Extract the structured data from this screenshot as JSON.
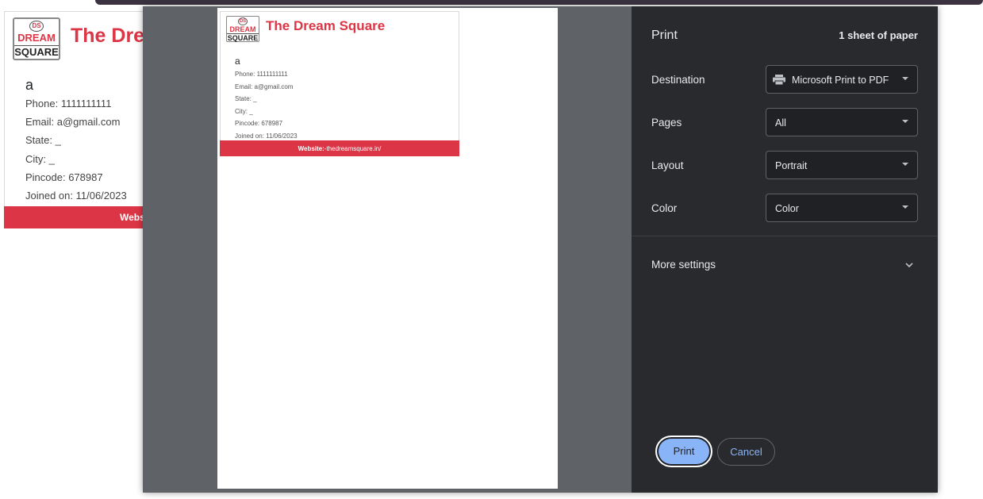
{
  "background_card": {
    "logo": {
      "ds": "DS",
      "dream": "DREAM",
      "square": "SQUARE"
    },
    "brand_partial": "The Dre",
    "name": "a",
    "phone": "Phone: 1111111111",
    "email": "Email: a@gmail.com",
    "state": "State: _",
    "city": "City: _",
    "pincode": "Pincode: 678987",
    "joined": "Joined on: 11/06/2023",
    "footer_partial": "Webs"
  },
  "preview_card": {
    "logo": {
      "ds": "DS",
      "dream": "DREAM",
      "square": "SQUARE"
    },
    "brand": "The Dream Square",
    "name": "a",
    "phone": "Phone: 1111111111",
    "email": "Email: a@gmail.com",
    "state": "State: _",
    "city": "City: _",
    "pincode": "Pincode: 678987",
    "joined": "Joined on: 11/06/2023",
    "footer_label": "Website:",
    "footer_url": "-thedreamsquare.in/"
  },
  "print_dialog": {
    "title": "Print",
    "sheet_count": "1 sheet of paper",
    "destination": {
      "label": "Destination",
      "value": "Microsoft Print to PDF",
      "icon": "printer-icon"
    },
    "pages": {
      "label": "Pages",
      "value": "All"
    },
    "layout": {
      "label": "Layout",
      "value": "Portrait"
    },
    "color": {
      "label": "Color",
      "value": "Color"
    },
    "more_settings": "More settings",
    "print_button": "Print",
    "cancel_button": "Cancel"
  },
  "colors": {
    "brand_red": "#dc3545",
    "panel_bg": "#292a2d",
    "preview_bg": "#5f6368",
    "accent_blue": "#8ab4f8"
  }
}
